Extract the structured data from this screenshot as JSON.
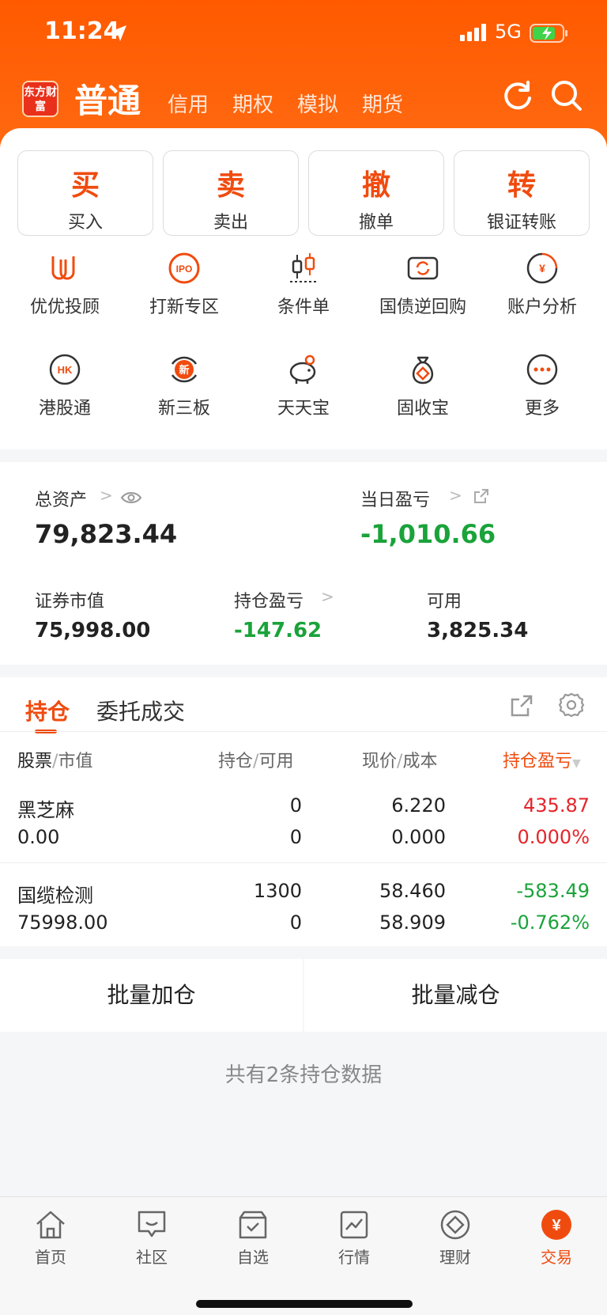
{
  "status": {
    "time": "11:24",
    "network": "5G"
  },
  "header": {
    "logo_text": "东方财富",
    "tabs": [
      {
        "label": "普通"
      },
      {
        "label": "信用"
      },
      {
        "label": "期权"
      },
      {
        "label": "模拟"
      },
      {
        "label": "期货"
      }
    ]
  },
  "quick_actions": [
    {
      "char": "买",
      "label": "买入"
    },
    {
      "char": "卖",
      "label": "卖出"
    },
    {
      "char": "撤",
      "label": "撤单"
    },
    {
      "char": "转",
      "label": "银证转账"
    }
  ],
  "grid": [
    {
      "label": "优优投顾",
      "icon": "uu-icon"
    },
    {
      "label": "打新专区",
      "icon": "ipo-icon"
    },
    {
      "label": "条件单",
      "icon": "candlestick-icon"
    },
    {
      "label": "国债逆回购",
      "icon": "repo-icon"
    },
    {
      "label": "账户分析",
      "icon": "account-analysis-icon"
    },
    {
      "label": "港股通",
      "icon": "hk-icon"
    },
    {
      "label": "新三板",
      "icon": "new-third-board-icon"
    },
    {
      "label": "天天宝",
      "icon": "piggy-bank-icon"
    },
    {
      "label": "固收宝",
      "icon": "money-bag-icon"
    },
    {
      "label": "更多",
      "icon": "more-icon"
    }
  ],
  "assets": {
    "total_label": "总资产",
    "total_value": "79,823.44",
    "daily_pl_label": "当日盈亏",
    "daily_pl_value": "-1,010.66",
    "market_value_label": "证券市值",
    "market_value": "75,998.00",
    "position_pl_label": "持仓盈亏",
    "position_pl": "-147.62",
    "available_label": "可用",
    "available": "3,825.34"
  },
  "positions": {
    "tabs": [
      "持仓",
      "委托成交"
    ],
    "headers": {
      "stock": "股票",
      "market_value": "市值",
      "hold": "持仓",
      "avail": "可用",
      "price": "现价",
      "cost": "成本",
      "pl": "持仓盈亏"
    },
    "sep": "/",
    "rows": [
      {
        "name": "黑芝麻",
        "mv": "0.00",
        "hold": "0",
        "avail": "0",
        "price": "6.220",
        "cost": "0.000",
        "pl": "435.87",
        "pl_pct": "0.000%",
        "color": "#e5252a"
      },
      {
        "name": "国缆检测",
        "mv": "75998.00",
        "hold": "1300",
        "avail": "0",
        "price": "58.460",
        "cost": "58.909",
        "pl": "-583.49",
        "pl_pct": "-0.762%",
        "color": "#1aa33a"
      }
    ]
  },
  "actions": {
    "add": "批量加仓",
    "reduce": "批量减仓"
  },
  "summary": "共有2条持仓数据",
  "tabbar": [
    {
      "label": "首页",
      "icon": "home-icon"
    },
    {
      "label": "社区",
      "icon": "community-icon"
    },
    {
      "label": "自选",
      "icon": "watchlist-icon"
    },
    {
      "label": "行情",
      "icon": "market-icon"
    },
    {
      "label": "理财",
      "icon": "wealth-icon"
    },
    {
      "label": "交易",
      "icon": "trade-icon"
    }
  ]
}
